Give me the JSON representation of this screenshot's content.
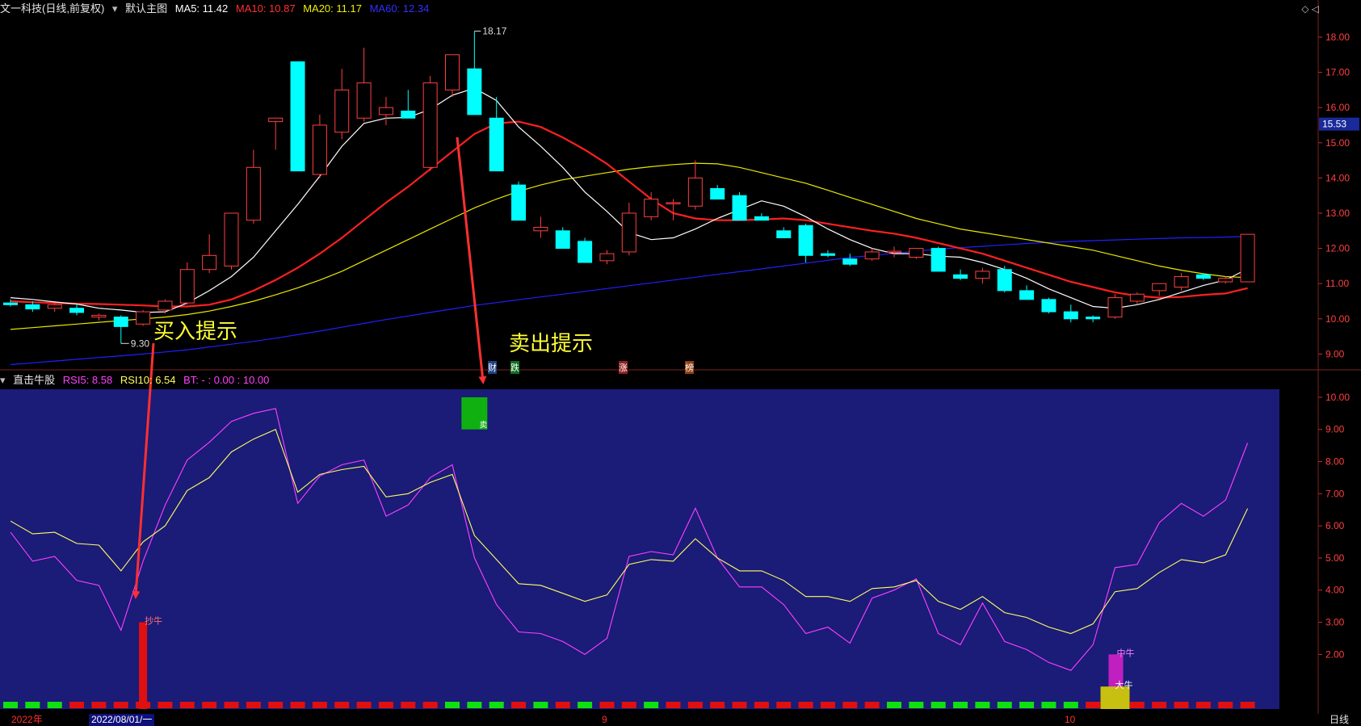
{
  "header": {
    "stock_name": "文一科技(日线,前复权)",
    "chart_menu": "默认主图",
    "ma5": "MA5: 11.42",
    "ma10": "MA10: 10.87",
    "ma20": "MA20: 11.17",
    "ma60": "MA60: 12.34"
  },
  "indicator_header": {
    "name": "直击牛股",
    "rsi5": "RSI5: 8.58",
    "rsi10": "RSI10: 6.54",
    "bt": "BT: - : 0.00 : 10.00"
  },
  "annotations": {
    "buy_hint": "买入提示",
    "sell_hint": "卖出提示",
    "high_marker": "18.17",
    "low_marker": "9.30",
    "price_tag": "15.53"
  },
  "event_tags": [
    "财",
    "跌",
    "涨",
    "榜"
  ],
  "bar_labels": {
    "sell": "卖",
    "buy": "抄牛",
    "mid_bull": "中牛",
    "big_bull": "大牛"
  },
  "bottom": {
    "year": "2022年",
    "cursor_date": "2022/08/01/一",
    "month_9": "9",
    "month_10": "10",
    "period": "日线"
  },
  "colors": {
    "up": "#ff4040",
    "down": "#00ffff",
    "ma5": "#ffffff",
    "ma10": "#ff2020",
    "ma20": "#e8e800",
    "ma60": "#2020ff",
    "panel_bg": "#1b1b78",
    "rsi5": "#ff40ff",
    "rsi10": "#ffff60"
  },
  "chart_data": [
    {
      "type": "candlestick",
      "title": "文一科技(日线,前复权)",
      "y_ticks": [
        "18.00",
        "17.00",
        "16.00",
        "15.00",
        "14.00",
        "13.00",
        "12.00",
        "11.00",
        "10.00",
        "9.00"
      ],
      "ylim": [
        8.55,
        18.55
      ],
      "ohlc": [
        [
          10.45,
          10.55,
          10.35,
          10.4
        ],
        [
          10.4,
          10.5,
          10.2,
          10.28
        ],
        [
          10.3,
          10.45,
          10.2,
          10.4
        ],
        [
          10.3,
          10.4,
          10.1,
          10.18
        ],
        [
          10.05,
          10.15,
          9.95,
          10.1
        ],
        [
          10.05,
          10.1,
          9.3,
          9.78
        ],
        [
          9.85,
          10.25,
          9.8,
          10.2
        ],
        [
          10.25,
          10.55,
          10.15,
          10.5
        ],
        [
          10.45,
          11.6,
          10.4,
          11.4
        ],
        [
          11.4,
          12.4,
          11.3,
          11.8
        ],
        [
          11.5,
          12.2,
          11.4,
          13.0
        ],
        [
          12.8,
          14.8,
          12.7,
          14.3
        ],
        [
          15.6,
          15.7,
          14.8,
          15.7
        ],
        [
          17.3,
          17.3,
          14.2,
          14.2
        ],
        [
          14.1,
          15.8,
          14.0,
          15.5
        ],
        [
          15.3,
          17.1,
          15.1,
          16.5
        ],
        [
          15.7,
          17.7,
          15.6,
          16.7
        ],
        [
          15.8,
          16.3,
          15.5,
          16.0
        ],
        [
          15.9,
          16.5,
          15.7,
          15.7
        ],
        [
          14.3,
          16.9,
          14.2,
          16.7
        ],
        [
          16.5,
          17.5,
          16.3,
          17.5
        ],
        [
          17.1,
          18.17,
          15.8,
          15.8
        ],
        [
          15.7,
          16.3,
          14.2,
          14.2
        ],
        [
          13.8,
          13.9,
          12.8,
          12.8
        ],
        [
          12.5,
          12.9,
          12.3,
          12.6
        ],
        [
          12.5,
          12.6,
          12.0,
          12.0
        ],
        [
          12.2,
          12.3,
          11.6,
          11.6
        ],
        [
          11.65,
          11.95,
          11.55,
          11.85
        ],
        [
          11.9,
          13.3,
          11.8,
          13.0
        ],
        [
          12.9,
          13.6,
          12.8,
          13.4
        ],
        [
          13.3,
          13.4,
          12.8,
          13.3
        ],
        [
          13.2,
          14.5,
          13.1,
          14.0
        ],
        [
          13.7,
          13.8,
          13.4,
          13.4
        ],
        [
          13.5,
          13.6,
          12.8,
          12.8
        ],
        [
          12.9,
          13.0,
          12.8,
          12.8
        ],
        [
          12.5,
          12.6,
          12.3,
          12.3
        ],
        [
          12.65,
          12.7,
          11.6,
          11.8
        ],
        [
          11.85,
          11.95,
          11.75,
          11.8
        ],
        [
          11.7,
          11.85,
          11.5,
          11.55
        ],
        [
          11.7,
          12.0,
          11.65,
          11.9
        ],
        [
          11.9,
          12.05,
          11.75,
          11.92
        ],
        [
          11.75,
          12.0,
          11.7,
          12.0
        ],
        [
          12.0,
          12.05,
          11.35,
          11.35
        ],
        [
          11.25,
          11.4,
          11.1,
          11.15
        ],
        [
          11.15,
          11.45,
          11.0,
          11.35
        ],
        [
          11.4,
          11.5,
          10.75,
          10.8
        ],
        [
          10.8,
          10.95,
          10.55,
          10.55
        ],
        [
          10.55,
          10.6,
          10.15,
          10.2
        ],
        [
          10.2,
          10.4,
          9.9,
          10.0
        ],
        [
          10.05,
          10.1,
          9.9,
          10.0
        ],
        [
          10.05,
          10.7,
          10.0,
          10.6
        ],
        [
          10.5,
          10.75,
          10.4,
          10.7
        ],
        [
          10.8,
          11.0,
          10.65,
          11.0
        ],
        [
          10.9,
          11.3,
          10.8,
          11.2
        ],
        [
          11.25,
          11.3,
          11.1,
          11.15
        ],
        [
          11.05,
          11.2,
          11.0,
          11.15
        ],
        [
          11.05,
          12.4,
          11.05,
          12.4
        ]
      ],
      "ma5": [
        10.6,
        10.55,
        10.48,
        10.42,
        10.3,
        10.25,
        10.18,
        10.2,
        10.45,
        10.8,
        11.2,
        11.75,
        12.5,
        13.25,
        14.05,
        14.9,
        15.55,
        15.7,
        15.72,
        15.95,
        16.35,
        16.55,
        16.2,
        15.45,
        14.9,
        14.3,
        13.6,
        13.05,
        12.45,
        12.25,
        12.3,
        12.55,
        12.85,
        13.1,
        13.35,
        13.2,
        12.9,
        12.55,
        12.25,
        12.0,
        11.85,
        11.85,
        11.78,
        11.75,
        11.6,
        11.4,
        11.15,
        10.85,
        10.6,
        10.35,
        10.3,
        10.4,
        10.55,
        10.75,
        10.95,
        11.1,
        11.42
      ],
      "ma10": [
        10.5,
        10.47,
        10.45,
        10.43,
        10.42,
        10.4,
        10.38,
        10.35,
        10.35,
        10.4,
        10.55,
        10.8,
        11.1,
        11.45,
        11.85,
        12.3,
        12.8,
        13.3,
        13.75,
        14.25,
        14.75,
        15.25,
        15.55,
        15.6,
        15.45,
        15.15,
        14.8,
        14.4,
        13.9,
        13.4,
        13.0,
        12.85,
        12.8,
        12.8,
        12.82,
        12.85,
        12.8,
        12.7,
        12.6,
        12.5,
        12.42,
        12.3,
        12.15,
        12.0,
        11.85,
        11.65,
        11.45,
        11.25,
        11.05,
        10.9,
        10.75,
        10.65,
        10.6,
        10.62,
        10.68,
        10.72,
        10.87
      ],
      "ma20": [
        9.7,
        9.75,
        9.8,
        9.85,
        9.9,
        9.95,
        10.0,
        10.05,
        10.12,
        10.22,
        10.35,
        10.5,
        10.68,
        10.88,
        11.1,
        11.35,
        11.65,
        11.95,
        12.25,
        12.55,
        12.85,
        13.15,
        13.4,
        13.62,
        13.8,
        13.95,
        14.05,
        14.15,
        14.25,
        14.32,
        14.38,
        14.42,
        14.4,
        14.3,
        14.15,
        14.0,
        13.85,
        13.65,
        13.45,
        13.25,
        13.05,
        12.85,
        12.7,
        12.55,
        12.45,
        12.35,
        12.25,
        12.15,
        12.05,
        11.95,
        11.8,
        11.65,
        11.5,
        11.38,
        11.28,
        11.2,
        11.17
      ],
      "ma60": [
        8.7,
        8.75,
        8.8,
        8.85,
        8.9,
        8.95,
        9.0,
        9.06,
        9.12,
        9.2,
        9.28,
        9.36,
        9.45,
        9.55,
        9.65,
        9.76,
        9.87,
        9.98,
        10.08,
        10.18,
        10.28,
        10.38,
        10.46,
        10.54,
        10.62,
        10.7,
        10.78,
        10.86,
        10.94,
        11.02,
        11.1,
        11.18,
        11.26,
        11.34,
        11.42,
        11.5,
        11.58,
        11.66,
        11.74,
        11.8,
        11.86,
        11.92,
        11.98,
        12.02,
        12.06,
        12.1,
        12.14,
        12.17,
        12.2,
        12.22,
        12.24,
        12.26,
        12.28,
        12.3,
        12.31,
        12.32,
        12.34
      ]
    },
    {
      "type": "line",
      "title": "直击牛股",
      "y_ticks": [
        "10.00",
        "9.00",
        "8.00",
        "7.00",
        "6.00",
        "5.00",
        "4.00",
        "3.00",
        "2.00"
      ],
      "ylim": [
        0.3,
        10.25
      ],
      "series": [
        {
          "name": "RSI5",
          "values": [
            5.8,
            4.9,
            5.05,
            4.3,
            4.15,
            2.75,
            4.9,
            6.65,
            8.05,
            8.6,
            9.25,
            9.5,
            9.65,
            6.7,
            7.55,
            7.9,
            8.05,
            6.3,
            6.65,
            7.5,
            7.9,
            5.0,
            3.55,
            2.7,
            2.65,
            2.4,
            2.0,
            2.5,
            5.05,
            5.2,
            5.1,
            6.55,
            5.0,
            4.1,
            4.1,
            3.55,
            2.65,
            2.85,
            2.35,
            3.75,
            4.0,
            4.35,
            2.65,
            2.3,
            3.6,
            2.4,
            2.15,
            1.75,
            1.5,
            2.3,
            4.7,
            4.8,
            6.1,
            6.7,
            6.3,
            6.8,
            8.58
          ]
        },
        {
          "name": "RSI10",
          "values": [
            6.15,
            5.75,
            5.8,
            5.45,
            5.4,
            4.6,
            5.5,
            6.0,
            7.1,
            7.5,
            8.3,
            8.7,
            9.0,
            7.05,
            7.6,
            7.75,
            7.85,
            6.9,
            7.0,
            7.35,
            7.6,
            5.7,
            4.95,
            4.2,
            4.15,
            3.9,
            3.65,
            3.85,
            4.8,
            4.95,
            4.9,
            5.6,
            5.0,
            4.6,
            4.6,
            4.3,
            3.8,
            3.8,
            3.65,
            4.05,
            4.1,
            4.3,
            3.65,
            3.4,
            3.8,
            3.3,
            3.15,
            2.85,
            2.65,
            2.95,
            3.95,
            4.05,
            4.55,
            4.95,
            4.85,
            5.1,
            6.54
          ]
        }
      ]
    }
  ]
}
